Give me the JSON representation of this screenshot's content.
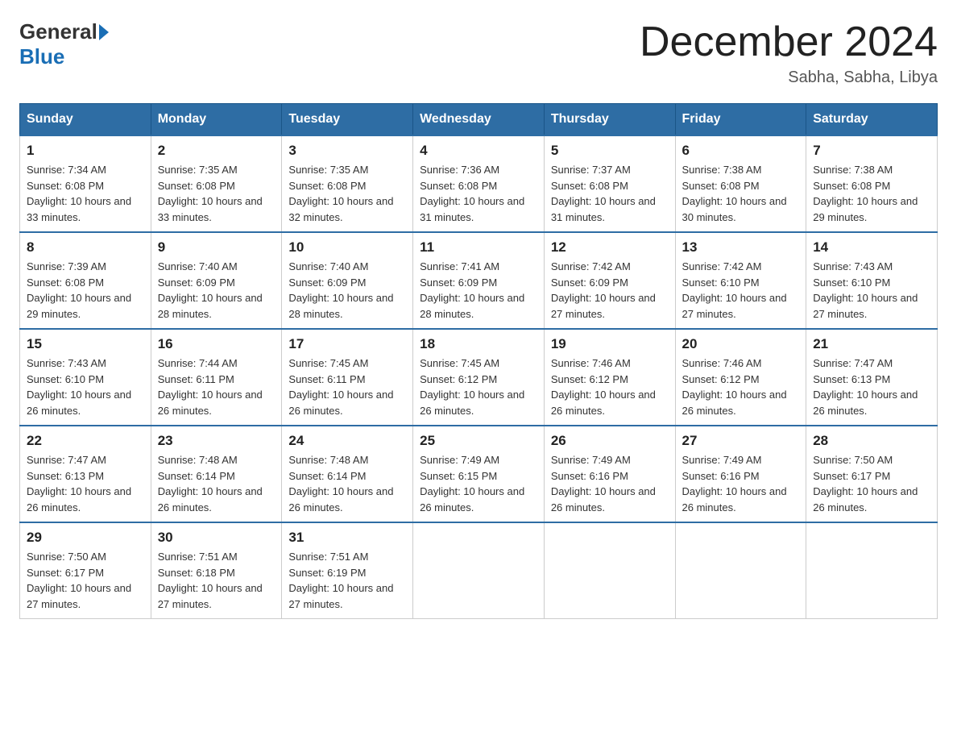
{
  "header": {
    "logo_general": "General",
    "logo_blue": "Blue",
    "month_title": "December 2024",
    "subtitle": "Sabha, Sabha, Libya"
  },
  "weekdays": [
    "Sunday",
    "Monday",
    "Tuesday",
    "Wednesday",
    "Thursday",
    "Friday",
    "Saturday"
  ],
  "weeks": [
    [
      {
        "day": "1",
        "sunrise": "7:34 AM",
        "sunset": "6:08 PM",
        "daylight": "10 hours and 33 minutes."
      },
      {
        "day": "2",
        "sunrise": "7:35 AM",
        "sunset": "6:08 PM",
        "daylight": "10 hours and 33 minutes."
      },
      {
        "day": "3",
        "sunrise": "7:35 AM",
        "sunset": "6:08 PM",
        "daylight": "10 hours and 32 minutes."
      },
      {
        "day": "4",
        "sunrise": "7:36 AM",
        "sunset": "6:08 PM",
        "daylight": "10 hours and 31 minutes."
      },
      {
        "day": "5",
        "sunrise": "7:37 AM",
        "sunset": "6:08 PM",
        "daylight": "10 hours and 31 minutes."
      },
      {
        "day": "6",
        "sunrise": "7:38 AM",
        "sunset": "6:08 PM",
        "daylight": "10 hours and 30 minutes."
      },
      {
        "day": "7",
        "sunrise": "7:38 AM",
        "sunset": "6:08 PM",
        "daylight": "10 hours and 29 minutes."
      }
    ],
    [
      {
        "day": "8",
        "sunrise": "7:39 AM",
        "sunset": "6:08 PM",
        "daylight": "10 hours and 29 minutes."
      },
      {
        "day": "9",
        "sunrise": "7:40 AM",
        "sunset": "6:09 PM",
        "daylight": "10 hours and 28 minutes."
      },
      {
        "day": "10",
        "sunrise": "7:40 AM",
        "sunset": "6:09 PM",
        "daylight": "10 hours and 28 minutes."
      },
      {
        "day": "11",
        "sunrise": "7:41 AM",
        "sunset": "6:09 PM",
        "daylight": "10 hours and 28 minutes."
      },
      {
        "day": "12",
        "sunrise": "7:42 AM",
        "sunset": "6:09 PM",
        "daylight": "10 hours and 27 minutes."
      },
      {
        "day": "13",
        "sunrise": "7:42 AM",
        "sunset": "6:10 PM",
        "daylight": "10 hours and 27 minutes."
      },
      {
        "day": "14",
        "sunrise": "7:43 AM",
        "sunset": "6:10 PM",
        "daylight": "10 hours and 27 minutes."
      }
    ],
    [
      {
        "day": "15",
        "sunrise": "7:43 AM",
        "sunset": "6:10 PM",
        "daylight": "10 hours and 26 minutes."
      },
      {
        "day": "16",
        "sunrise": "7:44 AM",
        "sunset": "6:11 PM",
        "daylight": "10 hours and 26 minutes."
      },
      {
        "day": "17",
        "sunrise": "7:45 AM",
        "sunset": "6:11 PM",
        "daylight": "10 hours and 26 minutes."
      },
      {
        "day": "18",
        "sunrise": "7:45 AM",
        "sunset": "6:12 PM",
        "daylight": "10 hours and 26 minutes."
      },
      {
        "day": "19",
        "sunrise": "7:46 AM",
        "sunset": "6:12 PM",
        "daylight": "10 hours and 26 minutes."
      },
      {
        "day": "20",
        "sunrise": "7:46 AM",
        "sunset": "6:12 PM",
        "daylight": "10 hours and 26 minutes."
      },
      {
        "day": "21",
        "sunrise": "7:47 AM",
        "sunset": "6:13 PM",
        "daylight": "10 hours and 26 minutes."
      }
    ],
    [
      {
        "day": "22",
        "sunrise": "7:47 AM",
        "sunset": "6:13 PM",
        "daylight": "10 hours and 26 minutes."
      },
      {
        "day": "23",
        "sunrise": "7:48 AM",
        "sunset": "6:14 PM",
        "daylight": "10 hours and 26 minutes."
      },
      {
        "day": "24",
        "sunrise": "7:48 AM",
        "sunset": "6:14 PM",
        "daylight": "10 hours and 26 minutes."
      },
      {
        "day": "25",
        "sunrise": "7:49 AM",
        "sunset": "6:15 PM",
        "daylight": "10 hours and 26 minutes."
      },
      {
        "day": "26",
        "sunrise": "7:49 AM",
        "sunset": "6:16 PM",
        "daylight": "10 hours and 26 minutes."
      },
      {
        "day": "27",
        "sunrise": "7:49 AM",
        "sunset": "6:16 PM",
        "daylight": "10 hours and 26 minutes."
      },
      {
        "day": "28",
        "sunrise": "7:50 AM",
        "sunset": "6:17 PM",
        "daylight": "10 hours and 26 minutes."
      }
    ],
    [
      {
        "day": "29",
        "sunrise": "7:50 AM",
        "sunset": "6:17 PM",
        "daylight": "10 hours and 27 minutes."
      },
      {
        "day": "30",
        "sunrise": "7:51 AM",
        "sunset": "6:18 PM",
        "daylight": "10 hours and 27 minutes."
      },
      {
        "day": "31",
        "sunrise": "7:51 AM",
        "sunset": "6:19 PM",
        "daylight": "10 hours and 27 minutes."
      },
      null,
      null,
      null,
      null
    ]
  ]
}
